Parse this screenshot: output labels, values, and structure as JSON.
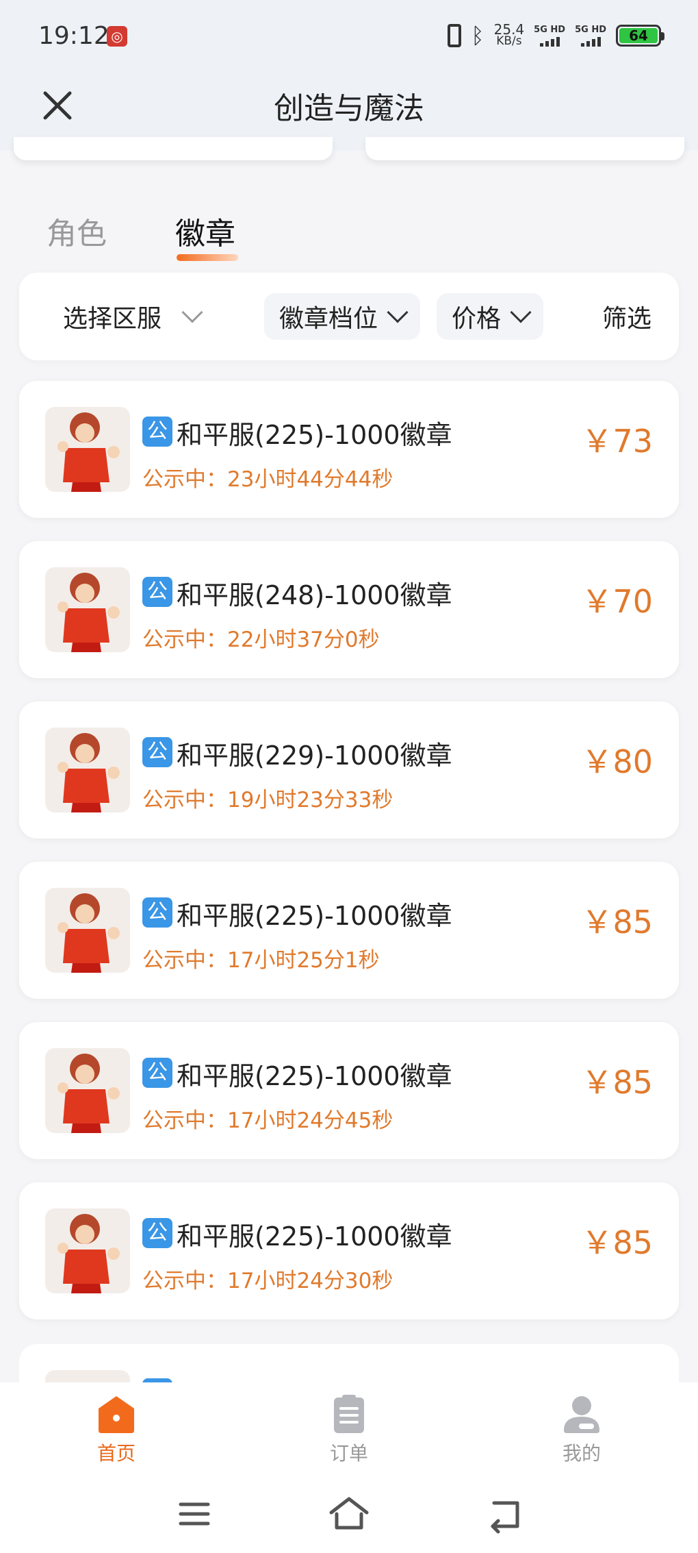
{
  "status_bar": {
    "time": "19:12",
    "netspeed_value": "25.4",
    "netspeed_unit": "KB/s",
    "sim1_label": "5G HD",
    "sim2_label": "5G HD",
    "battery": "64",
    "icons": [
      "netease-music-icon",
      "vibrate-icon",
      "bluetooth-icon",
      "signal-icon",
      "battery-icon"
    ]
  },
  "header": {
    "title": "创造与魔法",
    "close_icon": "close-icon"
  },
  "tabs": [
    {
      "label": "角色",
      "active": false
    },
    {
      "label": "徽章",
      "active": true
    }
  ],
  "filters": {
    "server": "选择区服",
    "badge_tier": "徽章档位",
    "price": "价格",
    "filter": "筛选"
  },
  "listings": [
    {
      "badge": "公",
      "title": "和平服(225)-1000徽章",
      "status": "公示中：23小时44分44秒",
      "price": "￥73"
    },
    {
      "badge": "公",
      "title": "和平服(248)-1000徽章",
      "status": "公示中：22小时37分0秒",
      "price": "￥70"
    },
    {
      "badge": "公",
      "title": "和平服(229)-1000徽章",
      "status": "公示中：19小时23分33秒",
      "price": "￥80"
    },
    {
      "badge": "公",
      "title": "和平服(225)-1000徽章",
      "status": "公示中：17小时25分1秒",
      "price": "￥85"
    },
    {
      "badge": "公",
      "title": "和平服(225)-1000徽章",
      "status": "公示中：17小时24分45秒",
      "price": "￥85"
    },
    {
      "badge": "公",
      "title": "和平服(225)-1000徽章",
      "status": "公示中：17小时24分30秒",
      "price": "￥85"
    }
  ],
  "bottom_nav": [
    {
      "label": "首页",
      "icon": "home-icon",
      "active": true
    },
    {
      "label": "订单",
      "icon": "clipboard-icon",
      "active": false
    },
    {
      "label": "我的",
      "icon": "user-icon",
      "active": false
    }
  ],
  "system_nav": [
    "menu-icon",
    "home-outline-icon",
    "back-icon"
  ],
  "colors": {
    "accent": "#e07a2d",
    "badge_blue": "#3a96e6",
    "active_tab_underline": "#f26b1d",
    "background": "#f5f5f7"
  }
}
